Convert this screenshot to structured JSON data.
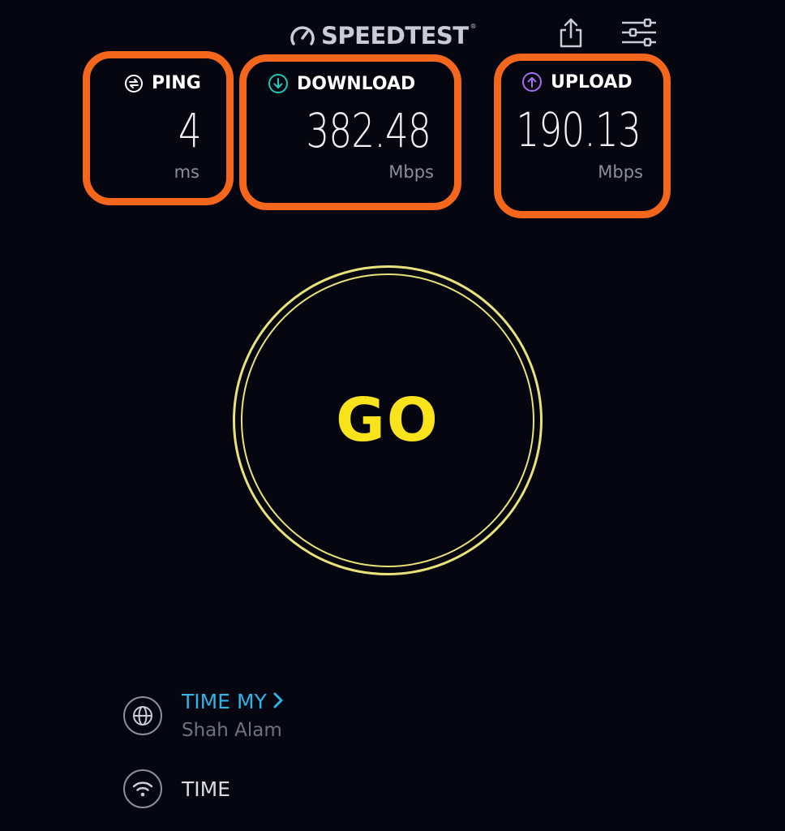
{
  "header": {
    "logo_text": "SPEEDTEST",
    "logo_tm": "®",
    "icons": [
      "speedometer-icon",
      "share-icon",
      "settings-sliders-icon"
    ]
  },
  "stats": {
    "ping": {
      "title": "PING",
      "value": "4",
      "unit": "ms",
      "icon": "ping-icon"
    },
    "download": {
      "title": "DOWNLOAD",
      "value": "382.48",
      "unit": "Mbps",
      "icon": "download-arrow-icon",
      "icon_color": "#21c7b7"
    },
    "upload": {
      "title": "UPLOAD",
      "value": "190.13",
      "unit": "Mbps",
      "icon": "upload-arrow-icon",
      "icon_color": "#a66cf0"
    }
  },
  "go_button": {
    "label": "GO"
  },
  "provider": {
    "name": "TIME MY",
    "location": "Shah Alam",
    "icon": "globe-icon"
  },
  "connection": {
    "name": "TIME",
    "icon": "wifi-icon"
  },
  "colors": {
    "background": "#05060f",
    "highlight_border": "#f4661c",
    "go_text": "#f9e41b",
    "go_ring": "#e9e27a",
    "provider_link": "#2fb3e8"
  }
}
